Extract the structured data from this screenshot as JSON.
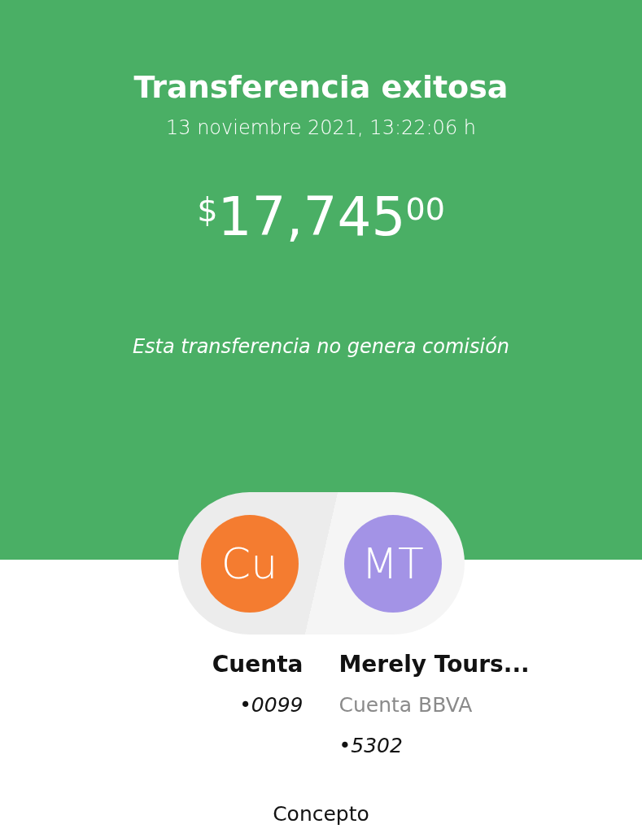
{
  "header": {
    "title": "Transferencia exitosa",
    "datetime": "13 noviembre 2021, 13:22:06 h"
  },
  "amount": {
    "currency": "$",
    "whole": "17,745",
    "cents": "00"
  },
  "note": "Esta transferencia no genera comisión",
  "parties": [
    {
      "initials": "Cu",
      "color": "#f47c30",
      "name": "Cuenta",
      "lines": [
        "•0099"
      ]
    },
    {
      "initials": "MT",
      "color": "#a393e6",
      "name": "Merely Tours...",
      "bank": "Cuenta BBVA",
      "lines": [
        "•5302"
      ]
    }
  ],
  "concept_label": "Concepto"
}
